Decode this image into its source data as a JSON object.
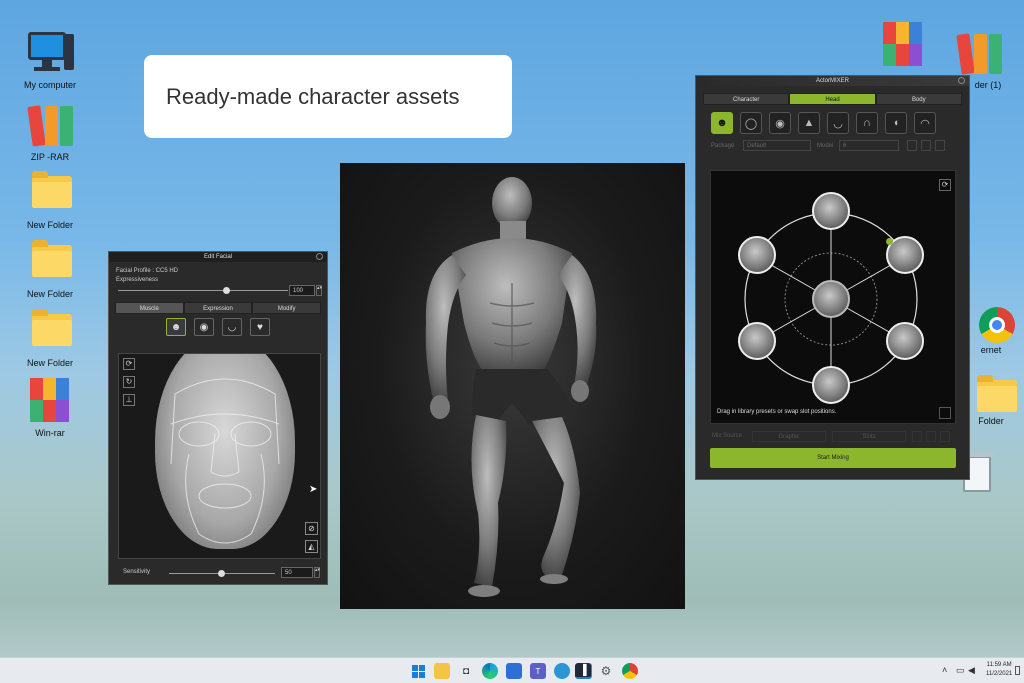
{
  "desktop": {
    "icons": [
      {
        "label": "My computer"
      },
      {
        "label": "ZIP -RAR"
      },
      {
        "label": "New Folder"
      },
      {
        "label": "New Folder"
      },
      {
        "label": "New Folder"
      },
      {
        "label": "Win-rar"
      }
    ],
    "right_icons": [
      {
        "label": "der (1)"
      },
      {
        "label": "ernet"
      },
      {
        "label": "Folder"
      }
    ]
  },
  "caption": {
    "text": "Ready-made character assets"
  },
  "edit_facial": {
    "title": "Edit Facial",
    "profile_label": "Facial Profile : CC5 HD",
    "expressiveness_label": "Expressiveness",
    "expressiveness_value": "100",
    "tabs": [
      "Muscle",
      "Expression",
      "Modify"
    ],
    "sensitivity_label": "Sensitivity",
    "sensitivity_value": "50"
  },
  "actor_mixer": {
    "title": "ActorMIXER",
    "tabs": [
      "Character",
      "Head",
      "Body"
    ],
    "active_tab": "Head",
    "row_labels": [
      "Package",
      "Model"
    ],
    "select_values": [
      "Default",
      "6"
    ],
    "hint": "Drag in library presets or swap slot positions.",
    "start_button": "Start Mixing",
    "bottom_label": "Mix Source",
    "bottom_btns": [
      "Graphic",
      "Slots"
    ]
  },
  "taskbar": {
    "time": "11:59 AM",
    "date": "11/2/2021"
  },
  "colors": {
    "accent": "#8cb72c"
  }
}
